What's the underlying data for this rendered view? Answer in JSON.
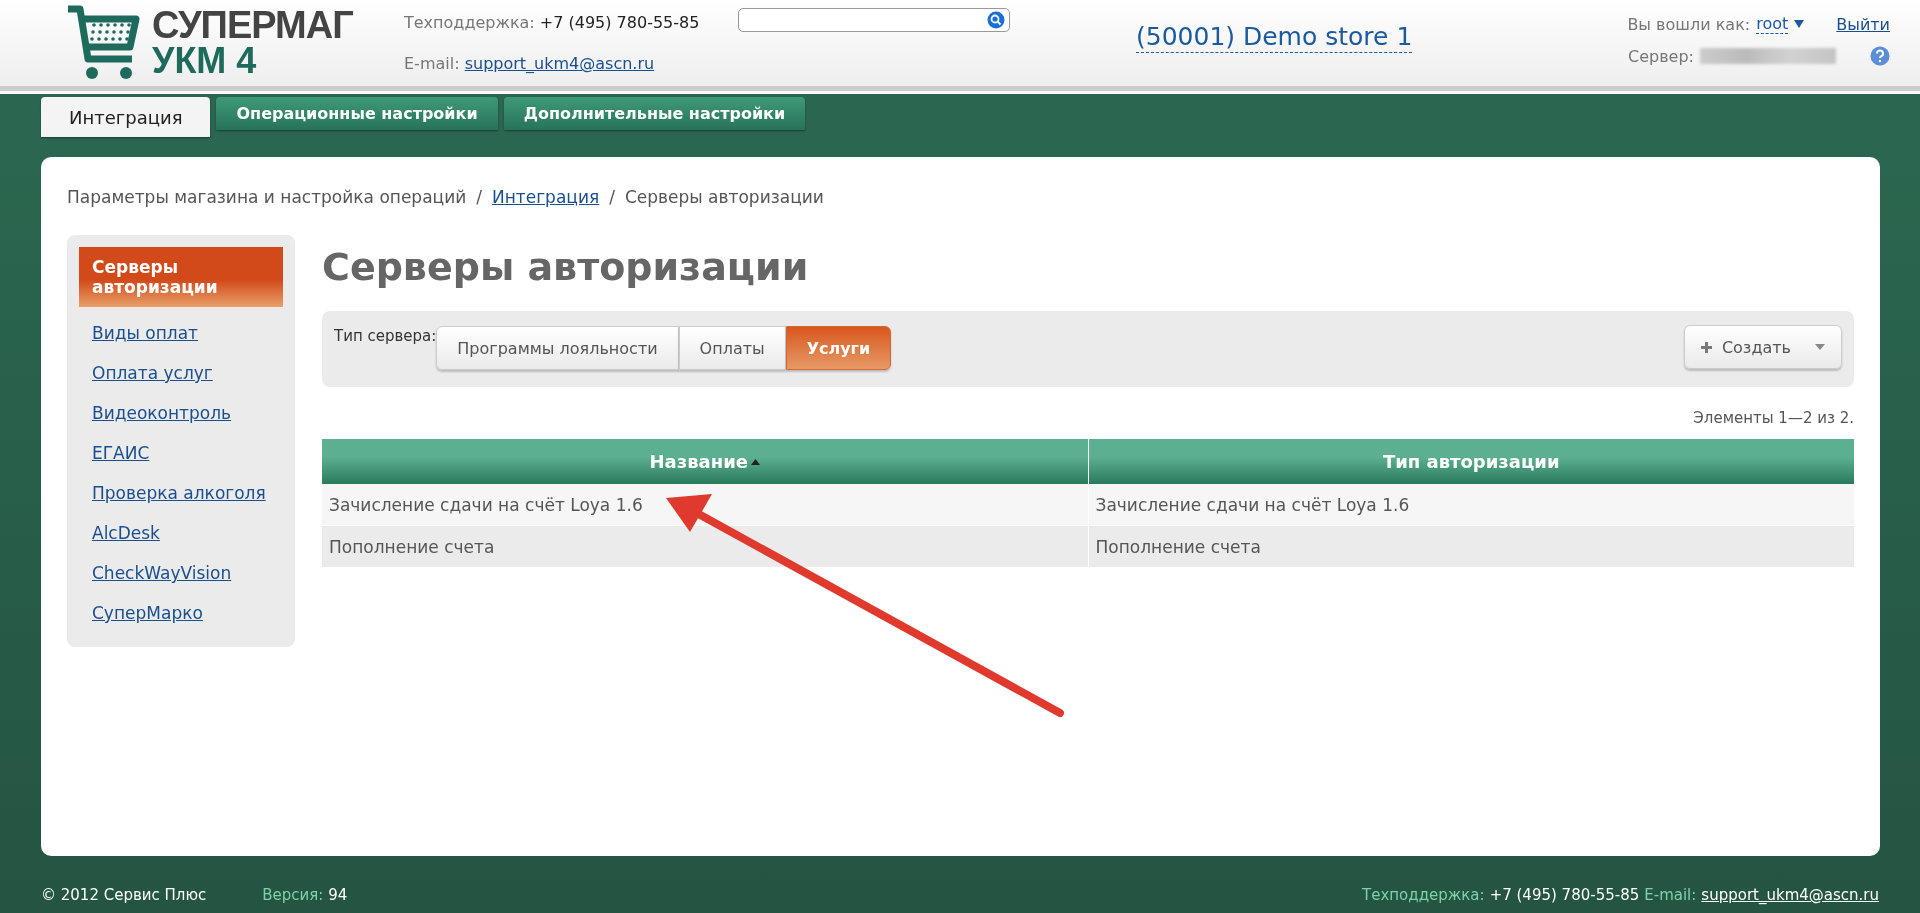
{
  "header": {
    "logo": {
      "line_1": "СУПЕРМАГ",
      "line_2": "УКМ 4"
    },
    "support_label": "Техподдержка:",
    "support_phone": "+7 (495) 780-55-85",
    "email_label": "E-mail:",
    "email": "support_ukm4@ascn.ru",
    "store": "(50001) Demo store 1",
    "logged_in_label": "Вы вошли как:",
    "user": "root",
    "logout": "Выйти",
    "server_label": "Сервер:"
  },
  "tabs": [
    {
      "label": "Интеграция",
      "selected": true
    },
    {
      "label": "Операционные настройки",
      "selected": false
    },
    {
      "label": "Дополнительные настройки",
      "selected": false
    }
  ],
  "breadcrumb": {
    "separator": "/",
    "items": [
      {
        "label": "Параметры магазина и настройка операций",
        "kind": "text"
      },
      {
        "label": "Интеграция",
        "kind": "link"
      },
      {
        "label": "Серверы авторизации",
        "kind": "text"
      }
    ]
  },
  "sidebar": {
    "items": [
      {
        "label": "Серверы авторизации",
        "selected": true
      },
      {
        "label": "Виды оплат",
        "selected": false
      },
      {
        "label": "Оплата услуг",
        "selected": false
      },
      {
        "label": "Видеоконтроль",
        "selected": false
      },
      {
        "label": "ЕГАИС",
        "selected": false
      },
      {
        "label": "Проверка алкоголя",
        "selected": false
      },
      {
        "label": "AlcDesk",
        "selected": false
      },
      {
        "label": "CheckWayVision",
        "selected": false
      },
      {
        "label": "СуперМарко",
        "selected": false
      }
    ]
  },
  "page_title": "Серверы авторизации",
  "filter": {
    "label": "Тип сервера:",
    "options": [
      {
        "label": "Программы лояльности",
        "selected": false
      },
      {
        "label": "Оплаты",
        "selected": false
      },
      {
        "label": "Услуги",
        "selected": true
      }
    ],
    "create_button": "Создать"
  },
  "count": "Элементы 1—2 из 2.",
  "table": {
    "columns": [
      {
        "label": "Название",
        "sorted": true
      },
      {
        "label": "Тип авторизации",
        "sorted": false
      }
    ],
    "rows": [
      [
        "Зачисление сдачи на счёт Loya 1.6",
        "Зачисление сдачи на счёт Loya 1.6"
      ],
      [
        "Пополнение счета",
        "Пополнение счета"
      ]
    ]
  },
  "footer": {
    "copyright": "© 2012 Сервис Плюс",
    "version_label": "Версия:",
    "version": "94",
    "support_label": "Техподдержка:",
    "support_phone": "+7 (495) 780-55-85",
    "email_label": "E-mail:",
    "email": "support_ukm4@ascn.ru"
  }
}
